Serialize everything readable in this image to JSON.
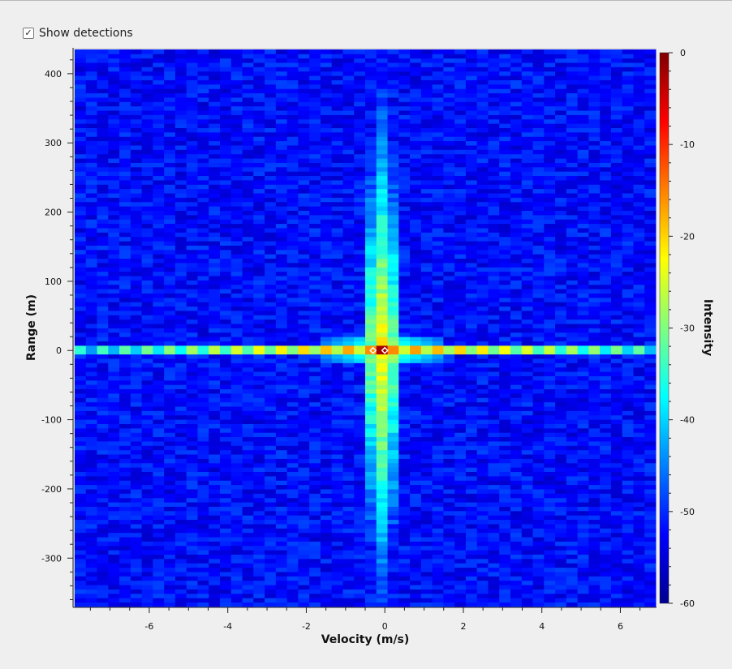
{
  "controls": {
    "show_detections_label": "Show detections",
    "show_detections_checked": true,
    "check_glyph": "✓"
  },
  "chart_data": {
    "type": "heatmap",
    "xlabel": "Velocity (m/s)",
    "ylabel": "Range (m)",
    "xlim": [
      -7.9,
      6.9
    ],
    "ylim": [
      -370,
      435
    ],
    "xticks": [
      -6,
      -4,
      -2,
      0,
      2,
      4,
      6
    ],
    "yticks": [
      400,
      300,
      200,
      100,
      0,
      -100,
      -200,
      -300
    ],
    "colorbar": {
      "label": "Intensity",
      "range": [
        -60,
        0
      ],
      "ticks": [
        0,
        -10,
        -20,
        -30,
        -40,
        -50,
        -60
      ],
      "colormap": "jet"
    },
    "noise_floor_db": -52,
    "peak": {
      "velocity": 0,
      "range": 0,
      "value_db": 0
    },
    "detections": [
      {
        "velocity": -0.3,
        "range": 0
      },
      {
        "velocity": 0,
        "range": 0
      }
    ],
    "detection_marker_color": "#ffffff"
  }
}
